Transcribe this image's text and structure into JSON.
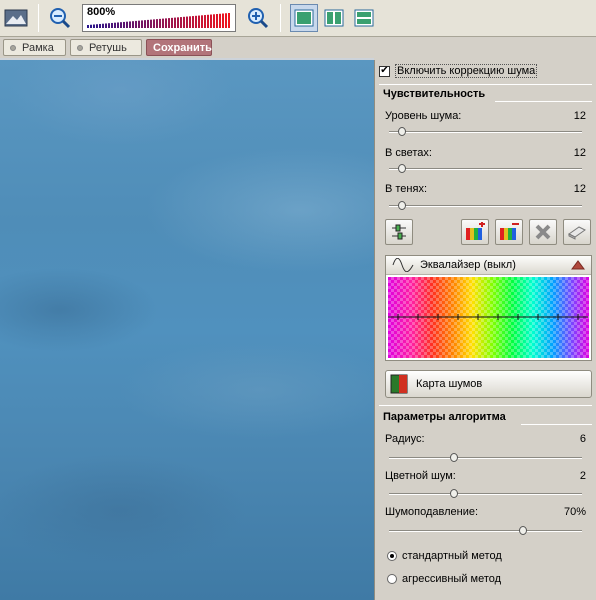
{
  "toolbar": {
    "zoom_value": "800%",
    "zoom_level": 8.0,
    "icons": [
      "image-preview-icon",
      "zoom-out-icon",
      "zoom-in-icon",
      "view-single-icon",
      "view-split-icon",
      "view-stacked-icon"
    ]
  },
  "tabs": [
    {
      "label": "Рамка"
    },
    {
      "label": "Ретушь"
    },
    {
      "label": "Сохранить"
    }
  ],
  "panel": {
    "enable_label": "Включить коррекцию шума",
    "enable_checked": true,
    "sensitivity": {
      "title": "Чувствительность",
      "noise_level": {
        "label": "Уровень шума:",
        "value": "12",
        "fraction": 0.05
      },
      "highlights": {
        "label": "В светах:",
        "value": "12",
        "fraction": 0.05
      },
      "shadows": {
        "label": "В тенях:",
        "value": "12",
        "fraction": 0.05
      }
    },
    "equalizer": {
      "label": "Эквалайзер (выкл)"
    },
    "noise_map": {
      "label": "Карта шумов"
    },
    "algorithm": {
      "title": "Параметры алгоритма",
      "radius": {
        "label": "Радиус:",
        "value": "6",
        "fraction": 0.33
      },
      "color_noise": {
        "label": "Цветной шум:",
        "value": "2",
        "fraction": 0.33
      },
      "suppression": {
        "label": "Шумоподавление:",
        "value": "70%",
        "fraction": 0.7
      },
      "methods": [
        {
          "label": "стандартный метод",
          "selected": true
        },
        {
          "label": "агрессивный метод",
          "selected": false
        }
      ]
    }
  },
  "colors": {
    "save_tab": "#b2747a",
    "canvas": "#4f8db8"
  }
}
